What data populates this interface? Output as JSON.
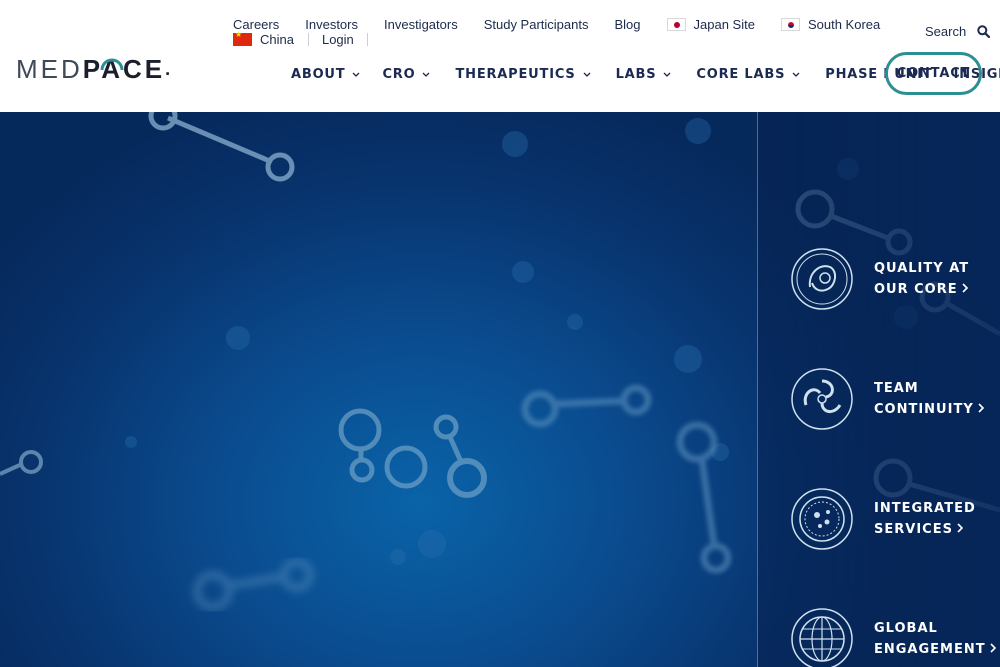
{
  "brand": {
    "logo_med": "MED",
    "logo_pace": "PACE",
    "logo_dot": "."
  },
  "utility_links": [
    {
      "label": "Careers"
    },
    {
      "label": "Investors"
    },
    {
      "label": "Investigators"
    },
    {
      "label": "Study Participants"
    },
    {
      "label": "Blog"
    },
    {
      "label": "Japan Site",
      "icon": "japan-flag-icon"
    },
    {
      "label": "South Korea",
      "icon": "south-korea-flag-icon"
    },
    {
      "label": "China",
      "icon": "china-flag-icon"
    },
    {
      "label": "Login"
    }
  ],
  "search": {
    "label": "Search",
    "icon": "search-icon"
  },
  "nav": [
    {
      "label": "ABOUT",
      "has_dropdown": true
    },
    {
      "label": "CRO",
      "has_dropdown": true
    },
    {
      "label": "THERAPEUTICS",
      "has_dropdown": true
    },
    {
      "label": "LABS",
      "has_dropdown": true
    },
    {
      "label": "CORE LABS",
      "has_dropdown": true
    },
    {
      "label": "PHASE I UNIT",
      "has_dropdown": false
    },
    {
      "label": "INSIGHTS",
      "has_dropdown": false
    }
  ],
  "cta": {
    "label": "CONTACT"
  },
  "features": [
    {
      "line1": "QUALITY AT",
      "line2": "OUR CORE",
      "icon": "quality-core-icon"
    },
    {
      "line1": "TEAM",
      "line2": "CONTINUITY",
      "icon": "team-continuity-icon"
    },
    {
      "line1": "INTEGRATED",
      "line2": "SERVICES",
      "icon": "integrated-services-icon"
    },
    {
      "line1": "GLOBAL",
      "line2": "ENGAGEMENT",
      "icon": "global-engagement-icon"
    }
  ],
  "colors": {
    "nav_text": "#1b2a52",
    "cta_border": "#2c8f96",
    "hero_dark": "#06295c",
    "hero_glow": "#0a63a8",
    "feature_text": "#ffffff"
  }
}
